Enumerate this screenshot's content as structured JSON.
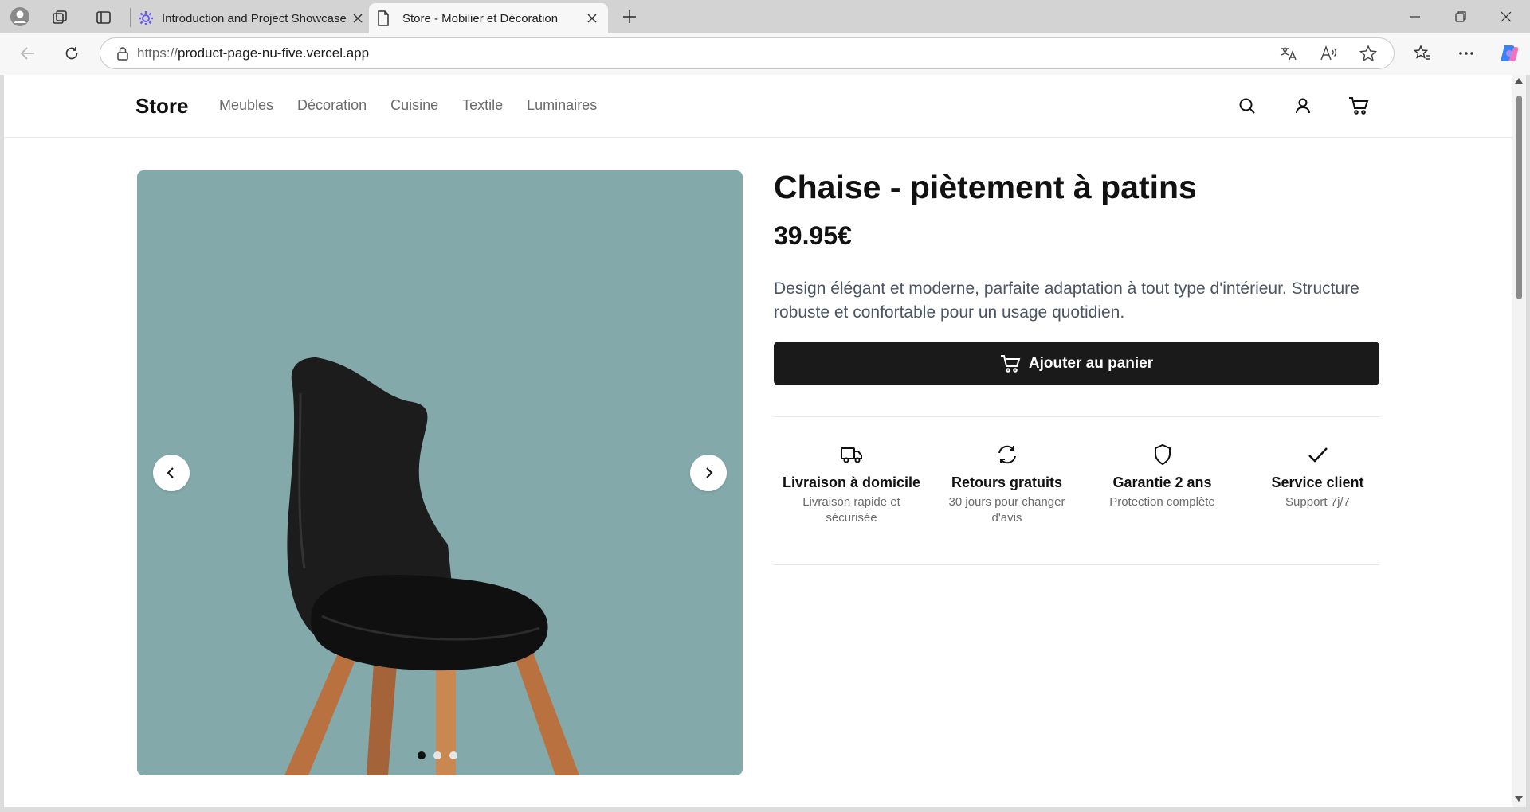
{
  "browser": {
    "tabs": [
      {
        "title": "Introduction and Project Showcase",
        "active": false
      },
      {
        "title": "Store - Mobilier et Décoration",
        "active": true
      }
    ],
    "url_scheme": "https://",
    "url_host": "product-page-nu-five.vercel.app"
  },
  "site": {
    "brand": "Store",
    "nav": [
      "Meubles",
      "Décoration",
      "Cuisine",
      "Textile",
      "Luminaires"
    ]
  },
  "product": {
    "title": "Chaise - piètement à patins",
    "price": "39.95€",
    "description": "Design élégant et moderne, parfaite adaptation à tout type d'intérieur. Structure robuste et confortable pour un usage quotidien.",
    "add_to_cart_label": "Ajouter au panier",
    "image_bg_color": "#84a9ab",
    "carousel": {
      "total": 3,
      "current": 1
    }
  },
  "features": [
    {
      "icon": "truck-icon",
      "title": "Livraison à domicile",
      "subtitle": "Livraison rapide et sécurisée"
    },
    {
      "icon": "refresh-icon",
      "title": "Retours gratuits",
      "subtitle": "30 jours pour changer d'avis"
    },
    {
      "icon": "shield-icon",
      "title": "Garantie 2 ans",
      "subtitle": "Protection complète"
    },
    {
      "icon": "check-icon",
      "title": "Service client",
      "subtitle": "Support 7j/7"
    }
  ]
}
